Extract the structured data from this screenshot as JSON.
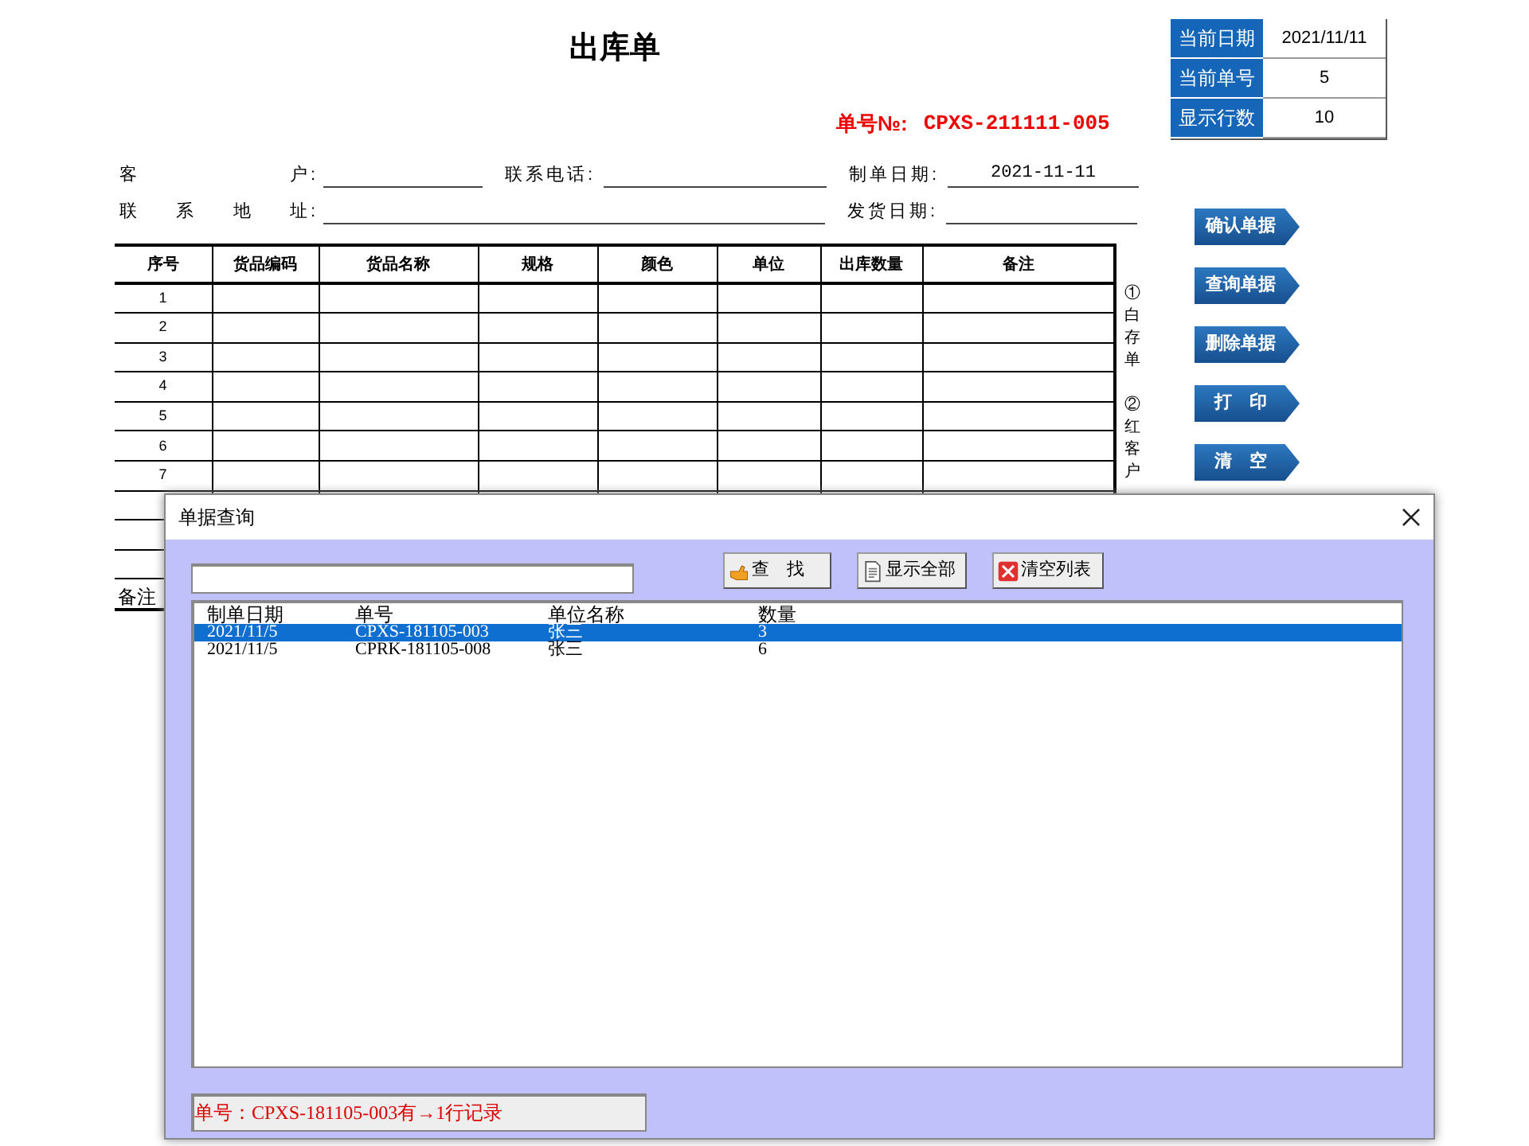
{
  "sheet": {
    "title": "出库单",
    "order_no_label": "单号№:",
    "order_no": "CPXS-211111-005",
    "field_rows": [
      [
        {
          "label": "客户",
          "colon": ":"
        },
        {
          "label": "联系电话:"
        },
        {
          "label": "制单日期:",
          "value": "2021-11-11"
        }
      ],
      [
        {
          "label": "联系地址",
          "colon": ":"
        },
        {
          "label": "发货日期:"
        }
      ]
    ],
    "table": {
      "columns": [
        "序号",
        "货品编码",
        "货品名称",
        "规格",
        "颜色",
        "单位",
        "出库数量",
        "备注"
      ],
      "rows": [
        {
          "no": "1"
        },
        {
          "no": "2"
        },
        {
          "no": "3"
        },
        {
          "no": "4"
        },
        {
          "no": "5"
        },
        {
          "no": "6"
        },
        {
          "no": "7"
        },
        {},
        {},
        {}
      ]
    },
    "remark_label": "备注",
    "side_notes": [
      "①白存单",
      "②红客户"
    ]
  },
  "info": [
    {
      "label": "当前日期",
      "value": "2021/11/11"
    },
    {
      "label": "当前单号",
      "value": "5"
    },
    {
      "label": "显示行数",
      "value": "10"
    }
  ],
  "actions": [
    "确认单据",
    "查询单据",
    "删除单据",
    "打　印",
    "清　空"
  ],
  "dialog": {
    "title": "单据查询",
    "buttons": [
      {
        "label": "查　找",
        "kind": "find"
      },
      {
        "label": "显示全部",
        "kind": "show_all"
      },
      {
        "label": "清空列表",
        "kind": "clear"
      }
    ],
    "list": {
      "columns": [
        "制单日期",
        "单号",
        "单位名称",
        "数量"
      ],
      "rows": [
        {
          "cells": [
            "2021/11/5",
            "CPXS-181105-003",
            "张三",
            "3"
          ],
          "selected": true
        },
        {
          "cells": [
            "2021/11/5",
            "CPRK-181105-008",
            "张三",
            "6"
          ],
          "selected": false
        }
      ]
    },
    "status": "单号：CPXS-181105-003有→1行记录"
  }
}
